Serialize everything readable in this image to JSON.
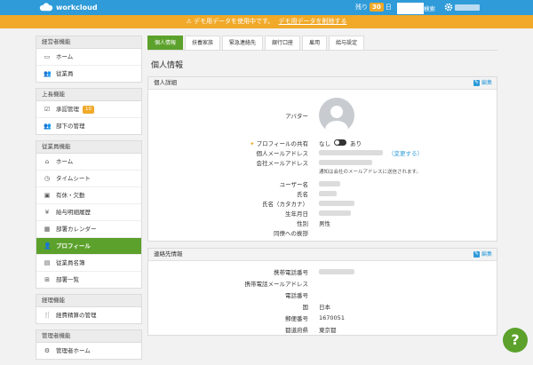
{
  "header": {
    "logo_text": "workcloud",
    "trial_prefix": "残り",
    "trial_days": "30",
    "trial_suffix": "日",
    "search_label": "検索"
  },
  "banner": {
    "message": "デモ用データを使用中です。",
    "action": "デモ用データを削除する"
  },
  "sidebar": {
    "groups": [
      {
        "title": "経営者機能",
        "items": [
          {
            "label": "ホーム"
          },
          {
            "label": "従業員"
          }
        ]
      },
      {
        "title": "上長機能",
        "items": [
          {
            "label": "承認管理",
            "badge": "10"
          },
          {
            "label": "部下の管理"
          }
        ]
      },
      {
        "title": "従業員機能",
        "items": [
          {
            "label": "ホーム"
          },
          {
            "label": "タイムシート"
          },
          {
            "label": "有休・欠勤"
          },
          {
            "label": "給与明細履歴"
          },
          {
            "label": "部署カレンダー"
          },
          {
            "label": "プロフィール"
          },
          {
            "label": "従業員名簿"
          },
          {
            "label": "部署一覧"
          }
        ]
      },
      {
        "title": "経理機能",
        "items": [
          {
            "label": "経費精算の管理"
          }
        ]
      },
      {
        "title": "管理者機能",
        "items": [
          {
            "label": "管理者ホーム"
          }
        ]
      }
    ]
  },
  "tabs": [
    "個人情報",
    "扶養家族",
    "緊急連絡先",
    "銀行口座",
    "雇用",
    "給与設定"
  ],
  "page_title": "個人情報",
  "personal": {
    "title": "個人詳細",
    "edit_label": "編集",
    "labels": {
      "avatar": "アバター",
      "profile_share": "プロフィールの共有",
      "personal_email": "個人メールアドレス",
      "company_email": "会社メールアドレス",
      "username": "ユーザー名",
      "name": "氏名",
      "name_kana": "氏名（カタカナ）",
      "birthday": "生年月日",
      "gender": "性別",
      "greeting": "同僚への挨拶"
    },
    "toggle_off": "なし",
    "toggle_on": "あり",
    "change_link": "（変更する）",
    "notice": "通知は会社のメールアドレスに送信されます。",
    "gender_value": "男性"
  },
  "contact": {
    "title": "連絡先情報",
    "edit_label": "編集",
    "labels": {
      "mobile": "携帯電話番号",
      "mobile_email": "携帯電話メールアドレス",
      "phone": "電話番号",
      "country": "国",
      "postal": "郵便番号",
      "prefecture": "都道府県"
    },
    "country_value": "日本",
    "postal_value": "1670051",
    "prefecture_value": "東京都"
  },
  "help_label": "?"
}
